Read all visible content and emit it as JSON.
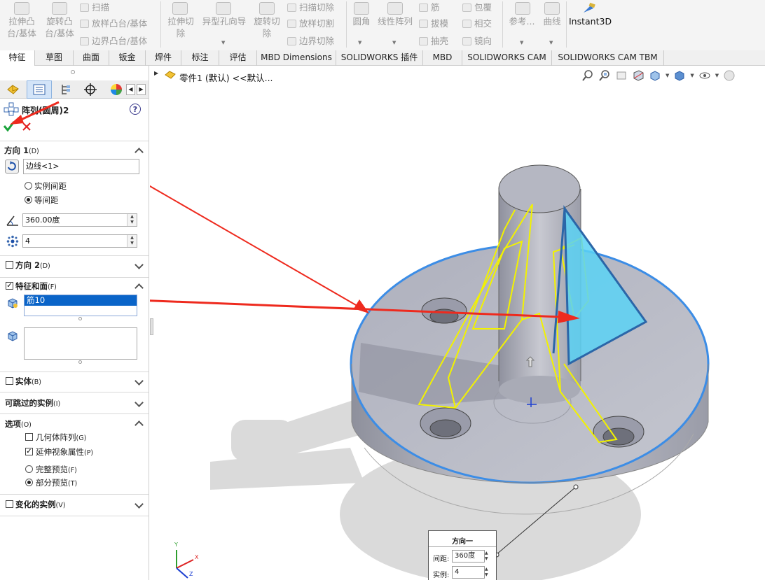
{
  "ribbon": {
    "buttons": [
      {
        "id": "extrude-boss",
        "label1": "拉伸凸",
        "label2": "台/基体"
      },
      {
        "id": "revolve-boss",
        "label1": "旋转凸",
        "label2": "台/基体"
      },
      {
        "id": "sweep-boss",
        "label": "扫描"
      },
      {
        "id": "loft-boss",
        "label": "放样凸台/基体"
      },
      {
        "id": "boundary-boss",
        "label": "边界凸台/基体"
      },
      {
        "id": "extruded-cut",
        "label1": "拉伸切",
        "label2": "除"
      },
      {
        "id": "hole-wizard",
        "label1": "异型孔向导"
      },
      {
        "id": "revolved-cut",
        "label1": "旋转切",
        "label2": "除"
      },
      {
        "id": "swept-cut",
        "label": "扫描切除"
      },
      {
        "id": "lofted-cut",
        "label": "放样切割"
      },
      {
        "id": "boundary-cut",
        "label": "边界切除"
      },
      {
        "id": "fillet",
        "label": "圆角"
      },
      {
        "id": "linear-pattern",
        "label": "线性阵列"
      },
      {
        "id": "rib",
        "label": "筋"
      },
      {
        "id": "draft",
        "label": "拔模"
      },
      {
        "id": "shell",
        "label": "抽壳"
      },
      {
        "id": "wrap",
        "label": "包覆"
      },
      {
        "id": "intersect",
        "label": "相交"
      },
      {
        "id": "mirror",
        "label": "镜向"
      },
      {
        "id": "reference-geometry",
        "label": "参考..."
      },
      {
        "id": "curves",
        "label": "曲线"
      },
      {
        "id": "instant3d",
        "label": "Instant3D"
      }
    ]
  },
  "tabs": [
    "特征",
    "草图",
    "曲面",
    "钣金",
    "焊件",
    "标注",
    "评估",
    "MBD Dimensions",
    "SOLIDWORKS 插件",
    "MBD",
    "SOLIDWORKS CAM",
    "SOLIDWORKS CAM TBM"
  ],
  "tree": {
    "breadcrumb": "零件1 (默认) <<默认..."
  },
  "property_manager": {
    "title": "阵列(圆周)2",
    "dir1": {
      "header": "方向 1",
      "header_suffix": "(D)",
      "edge": "边线<1>",
      "opt_spacing": "实例间距",
      "opt_equal": "等间距",
      "angle": "360.00度",
      "count": "4"
    },
    "dir2": {
      "header": "方向 2",
      "header_suffix": "(D)"
    },
    "features": {
      "header": "特征和面",
      "header_suffix": "(F)",
      "selected": "筋10"
    },
    "bodies": {
      "header": "实体",
      "header_suffix": "(B)"
    },
    "skip": {
      "header": "可跳过的实例",
      "header_suffix": "(I)"
    },
    "options": {
      "header": "选项",
      "header_suffix": "(O)",
      "geometry_pattern": "几何体阵列",
      "geometry_pattern_key": "(G)",
      "propagate": "延伸视象属性",
      "propagate_key": "(P)",
      "full_preview": "完整预览",
      "full_preview_key": "(F)",
      "partial_preview": "部分预览",
      "partial_preview_key": "(T)"
    },
    "vary": {
      "header": "变化的实例",
      "header_suffix": "(V)"
    }
  },
  "callout": {
    "title": "方向一",
    "spacing_label": "间距:",
    "spacing_value": "360度",
    "count_label": "实例:",
    "count_value": "4"
  },
  "triad": {
    "x": "X",
    "y": "Y",
    "z": "Z"
  },
  "colors": {
    "accent_blue": "#3c8de6",
    "selection_blue": "#0a64c8",
    "preview_yellow": "#f2f200",
    "rib_fill": "#5ad2f5",
    "arrow_red": "#ee2a1e",
    "part_gray": "#b6b8c4"
  },
  "icons": [
    "feature-manager-icon",
    "property-manager-icon",
    "config-manager-icon",
    "dimxpert-icon",
    "display-manager-icon",
    "ok-check-icon",
    "cancel-x-icon",
    "help-icon",
    "circular-pattern-icon",
    "rotate-direction-icon",
    "angle-icon",
    "instances-icon",
    "features-cube-icon",
    "faces-cube-icon",
    "zoom-fit-icon",
    "zoom-area-icon",
    "previous-view-icon",
    "section-view-icon",
    "view-orientation-icon",
    "display-style-icon",
    "hide-show-icon",
    "appearance-icon"
  ]
}
